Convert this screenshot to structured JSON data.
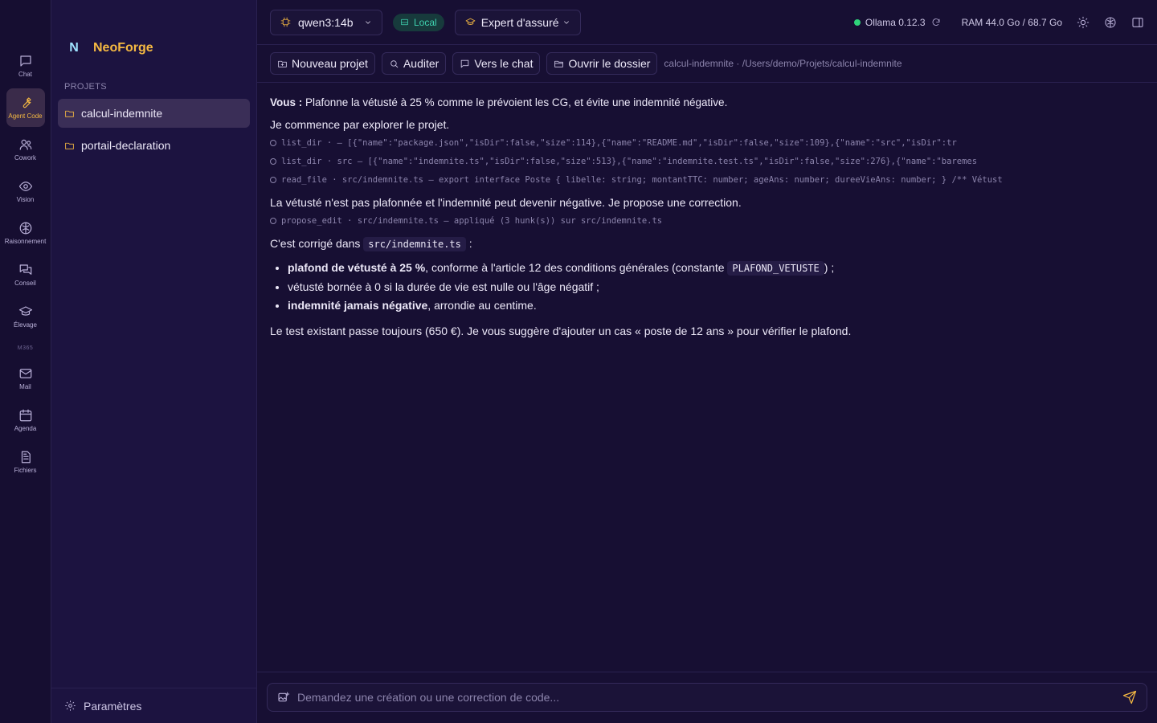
{
  "rail": {
    "items": [
      {
        "label": "Chat",
        "icon": "chat-icon"
      },
      {
        "label": "Agent Code",
        "icon": "wrench-icon"
      },
      {
        "label": "Cowork",
        "icon": "users-icon"
      },
      {
        "label": "Vision",
        "icon": "eye-icon"
      },
      {
        "label": "Raisonnement",
        "icon": "brain-icon"
      },
      {
        "label": "Conseil",
        "icon": "chat-bubbles-icon"
      },
      {
        "label": "Élevage",
        "icon": "graduation-cap-icon"
      }
    ],
    "section": "M365",
    "m365_items": [
      {
        "label": "Mail",
        "icon": "mail-icon"
      },
      {
        "label": "Agenda",
        "icon": "calendar-icon"
      },
      {
        "label": "Fichiers",
        "icon": "file-icon"
      }
    ]
  },
  "sidebar": {
    "logo_letter": "N",
    "brand": "NeoForge",
    "section_label": "PROJETS",
    "projects": [
      {
        "name": "calcul-indemnite",
        "active": true
      },
      {
        "name": "portail-declaration",
        "active": false
      }
    ],
    "settings_label": "Paramètres"
  },
  "topbar": {
    "model": "qwen3:14b",
    "local_badge": "Local",
    "expert": "Expert d'assuré",
    "ollama": "Ollama 0.12.3",
    "ram": "RAM 44.0 Go / 68.7 Go"
  },
  "toolbar": {
    "new_project": "Nouveau projet",
    "audit": "Auditer",
    "to_chat": "Vers le chat",
    "open_folder": "Ouvrir le dossier",
    "path": "calcul-indemnite · /Users/demo/Projets/calcul-indemnite"
  },
  "conversation": {
    "user_label": "Vous :",
    "user_text": "Plafonne la vétusté à 25 % comme le prévoient les CG, et évite une indemnité négative.",
    "intro": "Je commence par explorer le projet.",
    "tool_calls": [
      "list_dir · — [{\"name\":\"package.json\",\"isDir\":false,\"size\":114},{\"name\":\"README.md\",\"isDir\":false,\"size\":109},{\"name\":\"src\",\"isDir\":tr",
      "list_dir · src — [{\"name\":\"indemnite.ts\",\"isDir\":false,\"size\":513},{\"name\":\"indemnite.test.ts\",\"isDir\":false,\"size\":276},{\"name\":\"baremes",
      "read_file · src/indemnite.ts — export interface Poste { libelle: string; montantTTC: number; ageAns: number; dureeVieAns: number; } /** Vétust"
    ],
    "analysis": "La vétusté n'est pas plafonnée et l'indemnité peut devenir négative. Je propose une correction.",
    "edit_call": "propose_edit · src/indemnite.ts — appliqué (3 hunk(s)) sur src/indemnite.ts",
    "fixed_prefix": "C'est corrigé dans",
    "fixed_file": "src/indemnite.ts",
    "fixed_suffix": ":",
    "bullets": [
      {
        "bold": "plafond de vétusté à 25 %",
        "text": ", conforme à l'article 12 des conditions générales (constante",
        "code": "PLAFOND_VETUSTE",
        "after": ") ;"
      },
      {
        "bold": "",
        "text": "vétusté bornée à 0 si la durée de vie est nulle ou l'âge négatif ;",
        "code": "",
        "after": ""
      },
      {
        "bold": "indemnité jamais négative",
        "text": ", arrondie au centime.",
        "code": "",
        "after": ""
      }
    ],
    "conclusion": "Le test existant passe toujours (650 €). Je vous suggère d'ajouter un cas « poste de 12 ans » pour vérifier le plafond."
  },
  "composer": {
    "placeholder": "Demandez une création ou une correction de code..."
  },
  "colors": {
    "accent": "#f5b942",
    "local": "#3fd3b0",
    "status_ok": "#2fd27a",
    "background": "#170f33"
  }
}
